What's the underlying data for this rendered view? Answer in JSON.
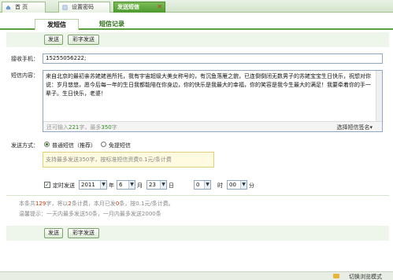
{
  "tabs": [
    {
      "label": "首 页"
    },
    {
      "label": "设置密码"
    },
    {
      "label": "发送短信"
    }
  ],
  "subtabs": {
    "send": "发短信",
    "history": "短信记录"
  },
  "toolbar": {
    "send": "发送",
    "color_send": "彩字发送"
  },
  "form": {
    "phone_label": "接收手机：",
    "phone_value": "15255056222;",
    "content_label": "短信内容：",
    "content_value": "来自北京的最初亲苏姥姥爸所托，我有宇宙超级大美女称号的，有沉鱼落雁之貌，已连倒倒闭无数男子的苏姥宝宝生日快乐，祝想对你说：岁月悠悠，愿今后每一年的生日我都能陪在你身边，你的快乐是我最大的幸福，你的笑容是我今生最大的满足！我要牵着你的手一辈子。生日快乐，老婆！",
    "count_prefix": "还可输入",
    "count_remaining": "221",
    "count_mid": "字，最多",
    "count_max": "350",
    "count_suffix": "字",
    "signature": "选择短信签名▾",
    "send_mode_label": "发送方式：",
    "mode_normal": "普通短信（推荐）",
    "mode_free": "免提短信",
    "hint": "支持最多发送350字，按标准短信资费0.1元/条计费",
    "timed_label": "定时发送",
    "year": "2011",
    "year_unit": "年",
    "month": "6",
    "month_unit": "月",
    "day": "23",
    "day_unit": "日",
    "hour": "0",
    "hour_unit": "时",
    "minute": "00",
    "minute_unit": "分"
  },
  "summary": {
    "prefix": "本条共",
    "chars": "129",
    "mid1": "字，将以",
    "parts": "2",
    "mid2": "条计费，本月已发",
    "sent": "0",
    "mid3": "条，按0.1元/条计费。",
    "tip": "温馨提示：一天内最多发送50条，一月内最多发送2000条"
  },
  "bottom_buttons": {
    "send": "发送",
    "color_send": "彩字发送"
  },
  "statusbar": {
    "label": "切换浏览模式"
  },
  "colors": {
    "accent_green": "#5aa03c",
    "tab_active": "#4d9a2e",
    "count_green": "#2c8c1a"
  }
}
